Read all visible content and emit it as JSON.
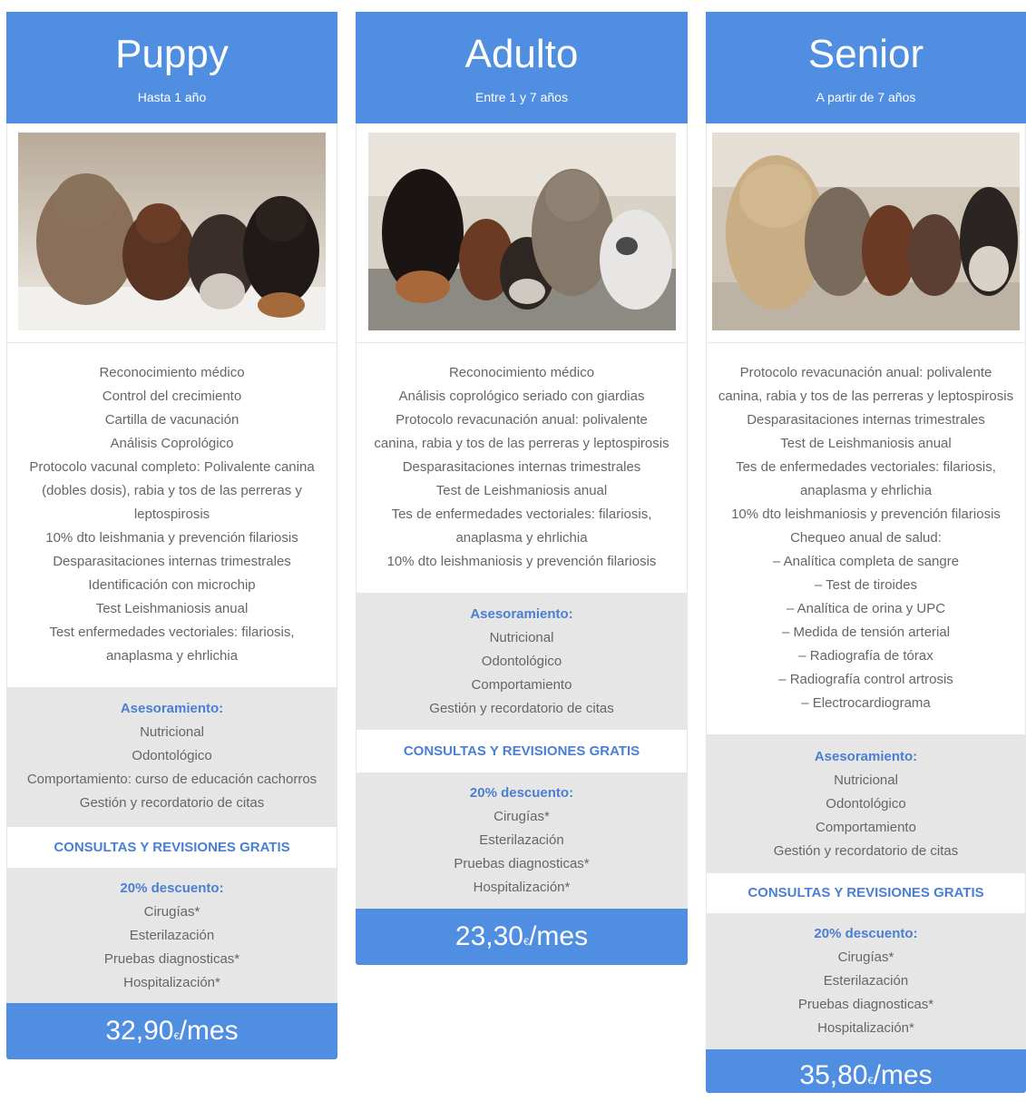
{
  "plans": [
    {
      "title": "Puppy",
      "subtitle": "Hasta 1 año",
      "features": [
        "Reconocimiento médico",
        "Control del crecimiento",
        "Cartilla de vacunación",
        "Análisis Coprológico",
        "Protocolo vacunal completo: Polivalente canina",
        "(dobles dosis), rabia y tos de las perreras y",
        "leptospirosis",
        "10% dto leishmania y prevención filariosis",
        "Desparasitaciones internas trimestrales",
        "Identificación con microchip",
        "Test Leishmaniosis anual",
        "Test enfermedades vectoriales: filariosis,",
        "anaplasma y ehrlichia"
      ],
      "advice_heading": "Asesoramiento:",
      "advice": [
        "Nutricional",
        "Odontológico",
        "Comportamiento: curso de educación cachorros",
        "Gestión y recordatorio de citas"
      ],
      "free_label": "CONSULTAS Y REVISIONES GRATIS",
      "discount_heading": "20% descuento:",
      "discounts": [
        "Cirugías*",
        "Esterilazación",
        "Pruebas diagnosticas*",
        "Hospitalización*"
      ],
      "price_amount": "32,90",
      "price_currency": "€",
      "price_period": "/mes"
    },
    {
      "title": "Adulto",
      "subtitle": "Entre 1 y 7 años",
      "features": [
        "Reconocimiento médico",
        "Análisis coprológico seriado con giardias",
        "Protocolo revacunación anual: polivalente",
        "canina, rabia y tos de las perreras y leptospirosis",
        "Desparasitaciones internas trimestrales",
        "Test de Leishmaniosis anual",
        "Tes de enfermedades vectoriales: filariosis,",
        "anaplasma y ehrlichia",
        "10% dto leishmaniosis y prevención filariosis"
      ],
      "advice_heading": "Asesoramiento:",
      "advice": [
        "Nutricional",
        "Odontológico",
        "Comportamiento",
        "Gestión y recordatorio de citas"
      ],
      "free_label": "CONSULTAS Y REVISIONES GRATIS",
      "discount_heading": "20% descuento:",
      "discounts": [
        "Cirugías*",
        "Esterilazación",
        "Pruebas diagnosticas*",
        "Hospitalización*"
      ],
      "price_amount": "23,30",
      "price_currency": "€",
      "price_period": "/mes"
    },
    {
      "title": "Senior",
      "subtitle": "A partir de 7 años",
      "features": [
        "Protocolo revacunación anual: polivalente",
        "canina, rabia y tos de las perreras y leptospirosis",
        "Desparasitaciones internas trimestrales",
        "Test de Leishmaniosis anual",
        "Tes de enfermedades vectoriales: filariosis,",
        "anaplasma y ehrlichia",
        "10% dto leishmaniosis y prevención filariosis",
        "Chequeo anual de salud:",
        "– Analítica completa de sangre",
        "– Test de tiroides",
        "– Analítica de orina y UPC",
        "– Medida de tensión arterial",
        "– Radiografía de tórax",
        "– Radiografía control artrosis",
        "– Electrocardiograma"
      ],
      "advice_heading": "Asesoramiento:",
      "advice": [
        "Nutricional",
        "Odontológico",
        "Comportamiento",
        "Gestión y recordatorio de citas"
      ],
      "free_label": "CONSULTAS Y REVISIONES GRATIS",
      "discount_heading": "20% descuento:",
      "discounts": [
        "Cirugías*",
        "Esterilazación",
        "Pruebas diagnosticas*",
        "Hospitalización*"
      ],
      "price_amount": "35,80",
      "price_currency": "€",
      "price_period": "/mes"
    }
  ],
  "colors": {
    "accent": "#4f8ee0",
    "heading_blue": "#4a7fd4",
    "grey_band": "#e6e6e6",
    "text": "#666666"
  }
}
